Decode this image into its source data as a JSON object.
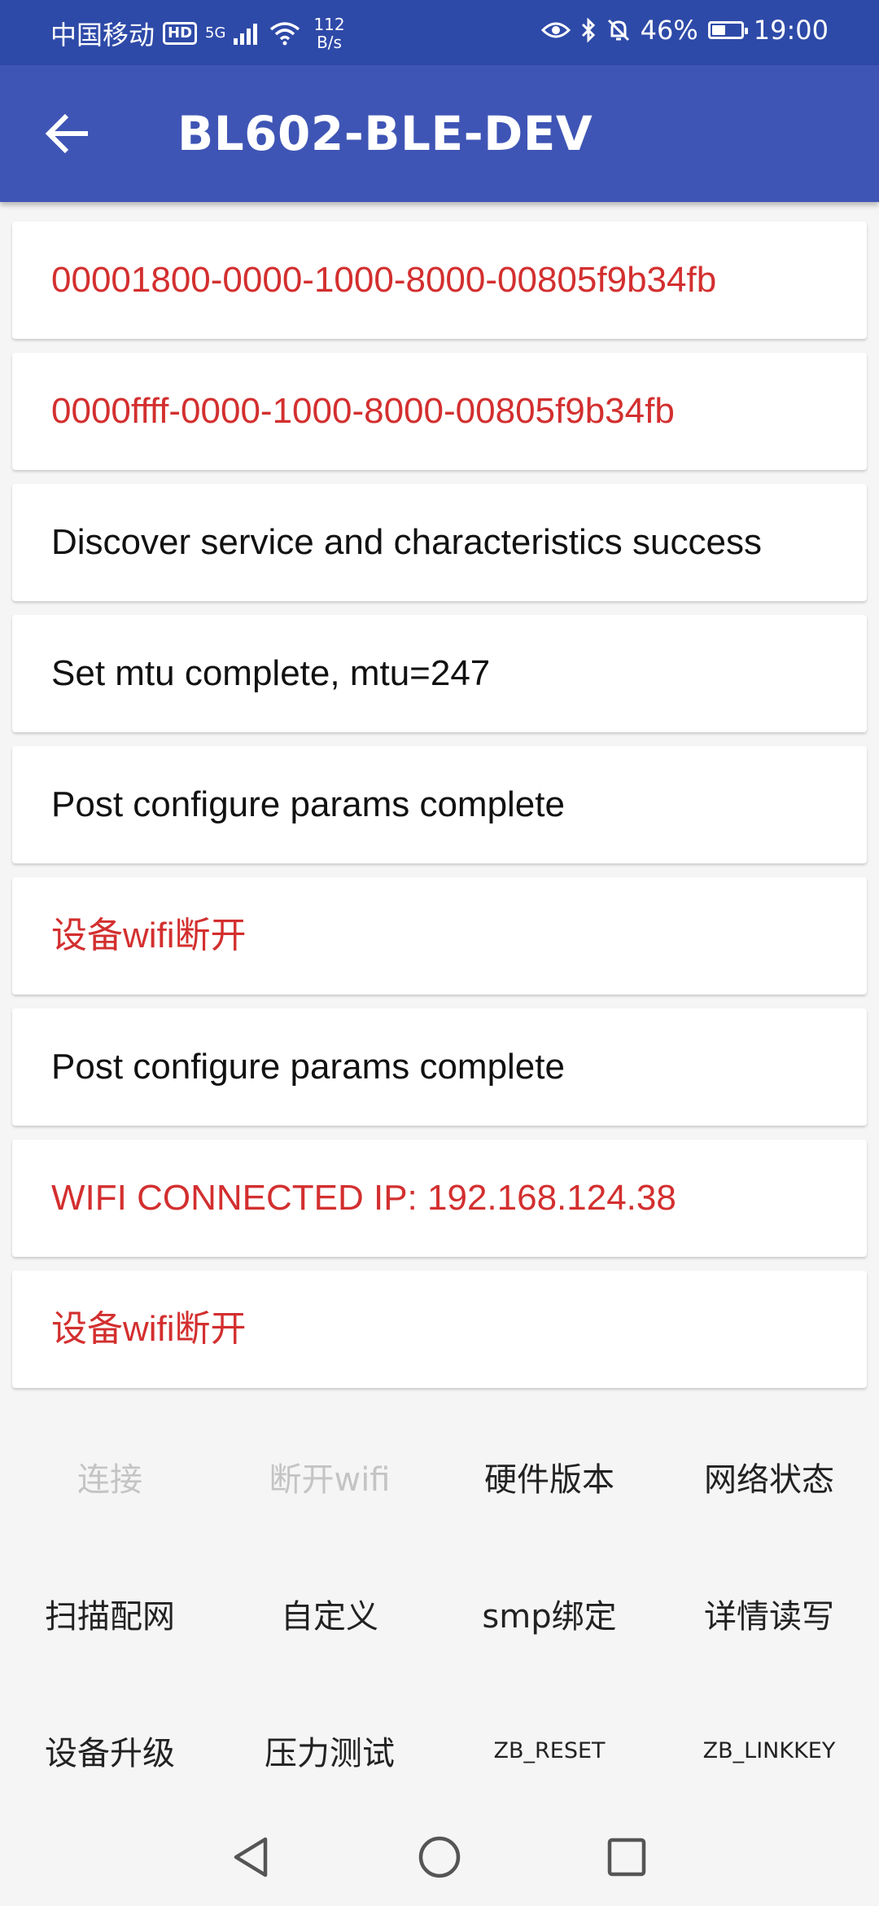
{
  "status_bar": {
    "carrier": "中国移动",
    "hd_badge": "HD",
    "network": "5G",
    "speed_value": "112",
    "speed_unit": "B/s",
    "battery_percent": "46%",
    "battery_level": 0.46,
    "time": "19:00"
  },
  "app_bar": {
    "title": "BL602-BLE-DEV",
    "back_icon": "arrow-back-icon"
  },
  "log_items": [
    {
      "text": "00001800-0000-1000-8000-00805f9b34fb",
      "color": "#d32f2f"
    },
    {
      "text": "0000ffff-0000-1000-8000-00805f9b34fb",
      "color": "#d32f2f"
    },
    {
      "text": "Discover service and characteristics success",
      "color": "#111111"
    },
    {
      "text": "Set mtu complete, mtu=247",
      "color": "#111111"
    },
    {
      "text": "Post configure params complete",
      "color": "#111111"
    },
    {
      "text": "设备wifi断开",
      "color": "#d32f2f"
    },
    {
      "text": "Post configure params complete",
      "color": "#111111"
    },
    {
      "text": "WIFI CONNECTED IP: 192.168.124.38",
      "color": "#d32f2f"
    },
    {
      "text": "设备wifi断开",
      "color": "#d32f2f"
    }
  ],
  "buttons": {
    "connect": "连接",
    "disconnect_wifi": "断开wifi",
    "hardware_version": "硬件版本",
    "network_status": "网络状态",
    "scan_config": "扫描配网",
    "custom": "自定义",
    "smp_bind": "smp绑定",
    "detail_rw": "详情读写",
    "device_upgrade": "设备升级",
    "stress_test": "压力测试",
    "zb_reset": "ZB_RESET",
    "zb_linkkey": "ZB_LINKKEY"
  },
  "colors": {
    "status_bar": "#2e4aa8",
    "app_bar": "#3f55b5",
    "error_text": "#d32f2f",
    "disabled_text": "#c4c4c4"
  }
}
